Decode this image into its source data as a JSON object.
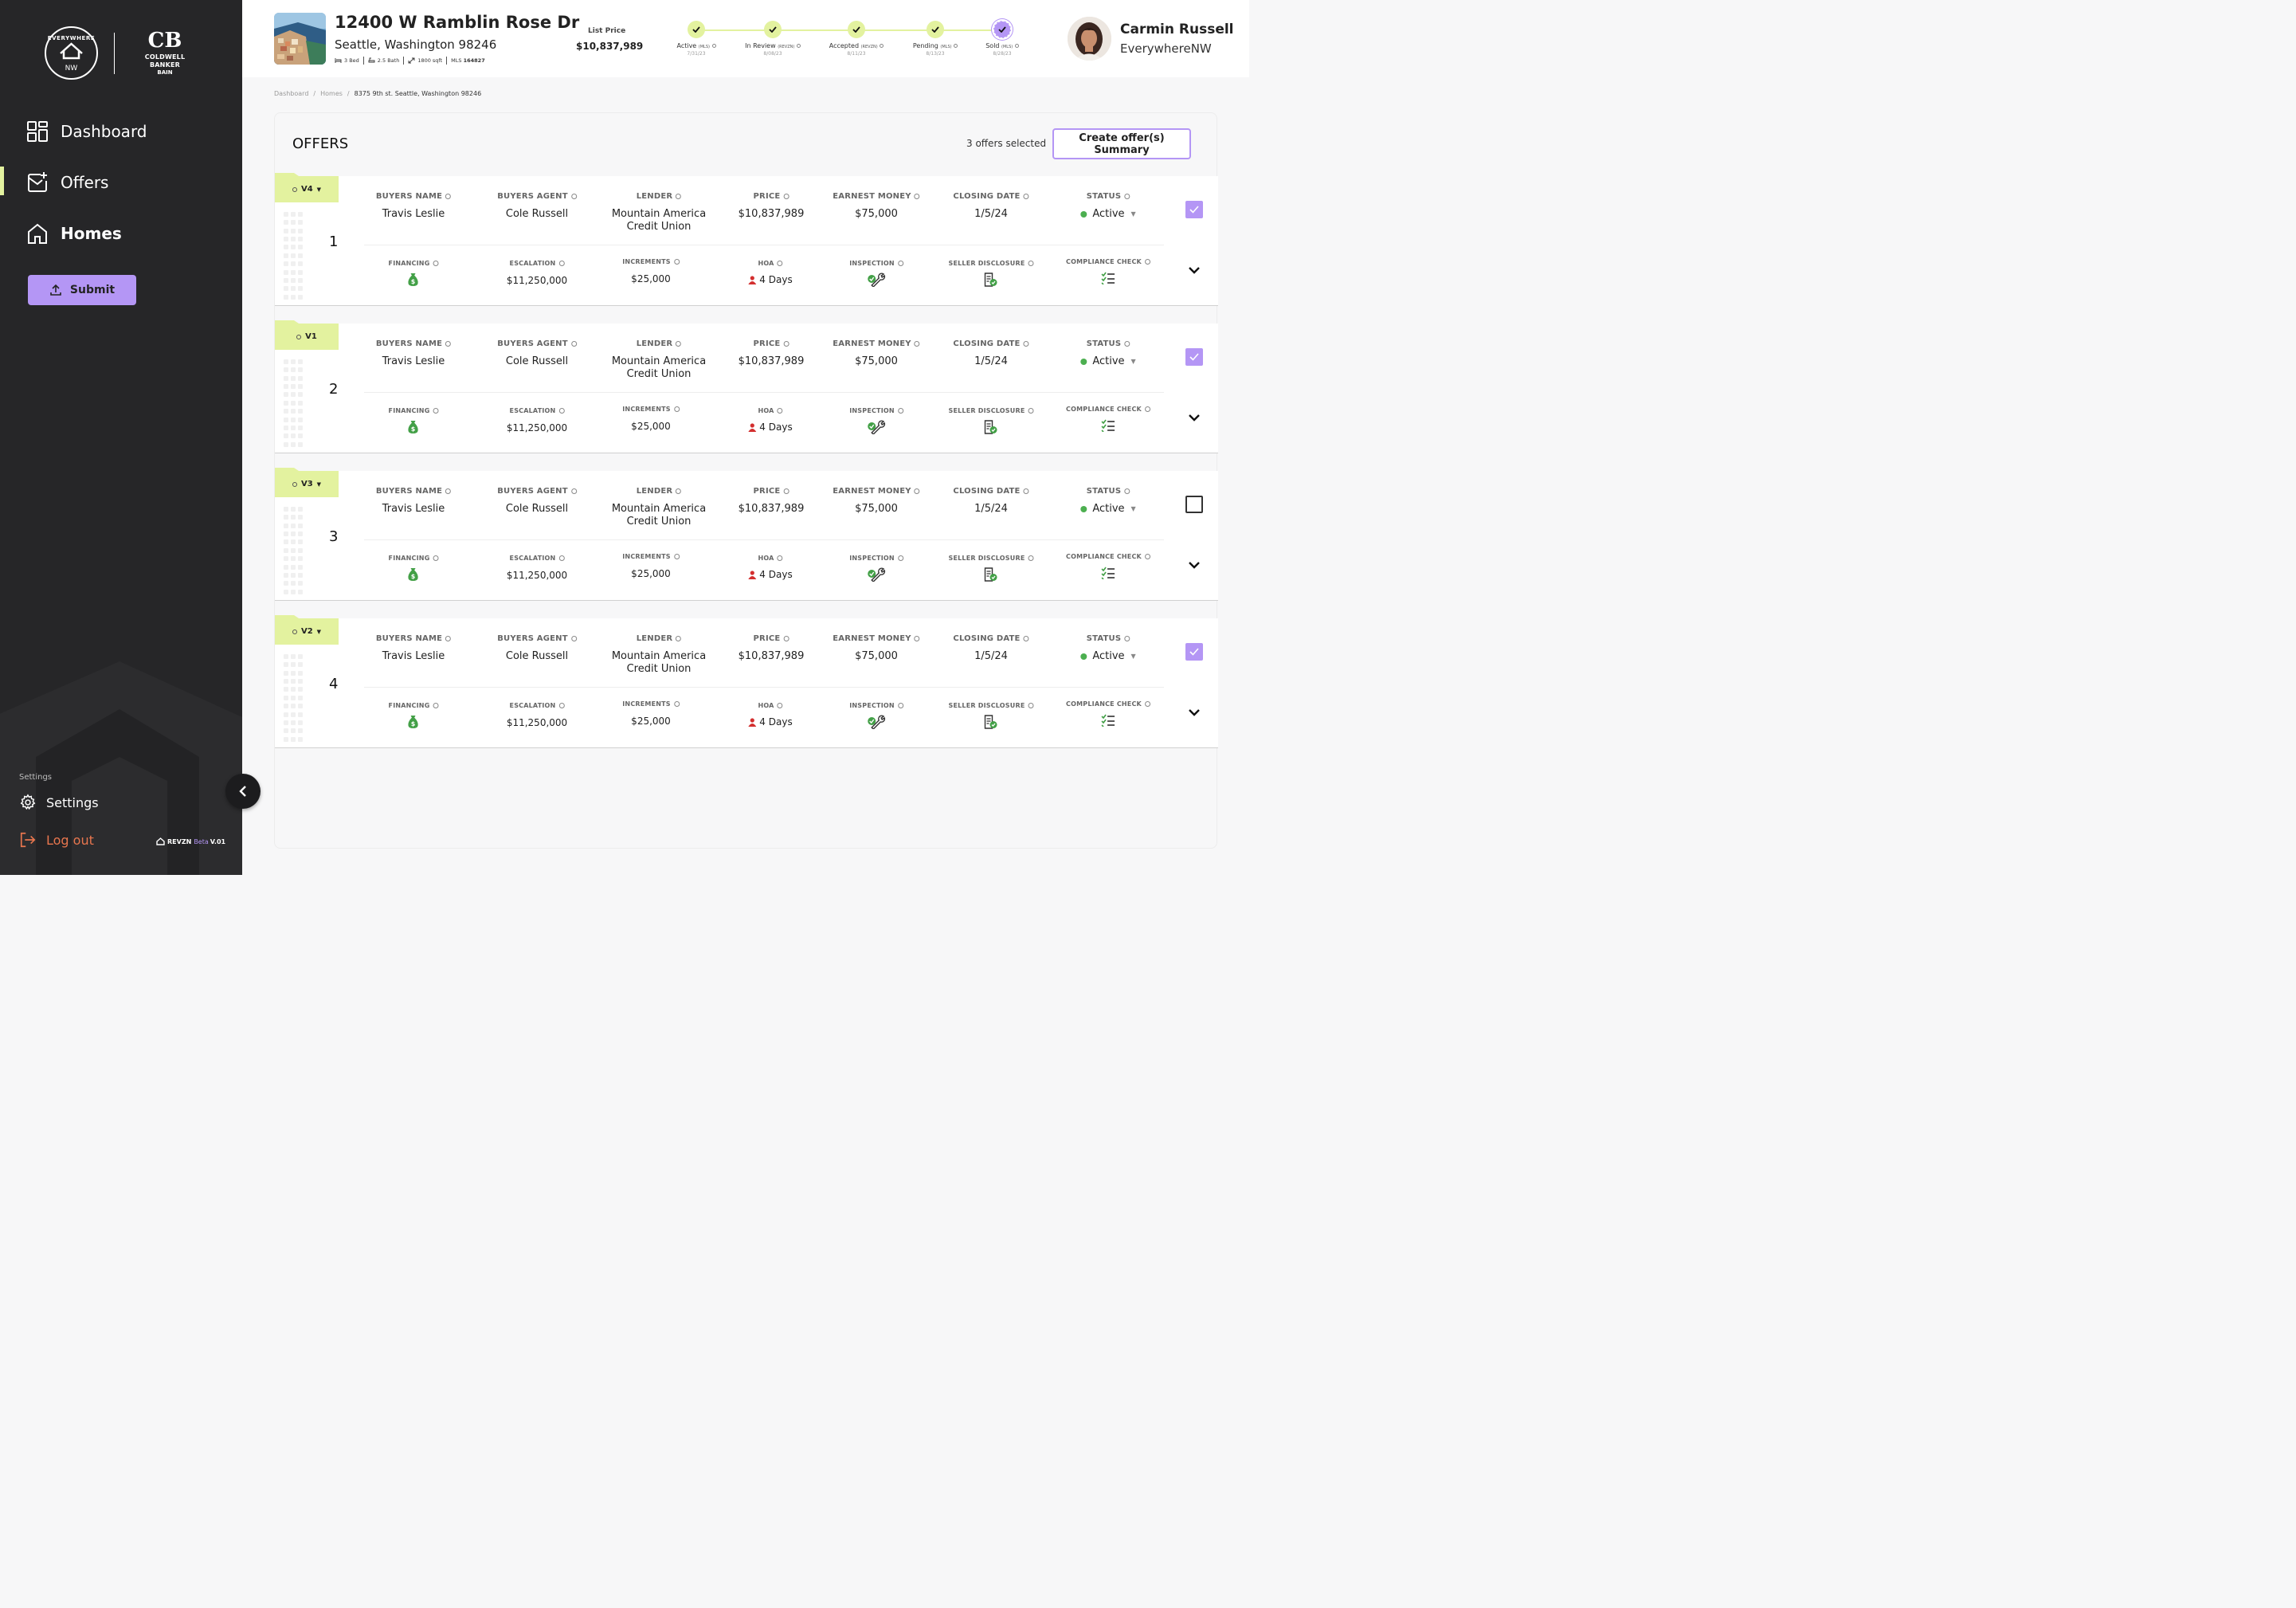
{
  "brand": {
    "logo_text": "EVERYWHERE NW",
    "partner_logo_name": "COLDWELL BANKER",
    "partner_logo_sub": "BAIN"
  },
  "sidebar": {
    "items": [
      {
        "label": "Dashboard",
        "icon": "dashboard-icon"
      },
      {
        "label": "Offers",
        "icon": "offers-icon",
        "active": true
      },
      {
        "label": "Homes",
        "icon": "home-icon"
      }
    ],
    "submit_label": "Submit",
    "settings_heading": "Settings",
    "settings_label": "Settings",
    "logout_label": "Log out",
    "version": {
      "name": "REVZN",
      "beta": "Beta",
      "ver": "V.01"
    }
  },
  "property": {
    "address": "12400 W Ramblin Rose Dr",
    "city": "Seattle, Washington 98246",
    "beds": "3 Bed",
    "baths": "2.5 Bath",
    "sqft": "1800 sqft",
    "mls_label": "MLS",
    "mls": "164827",
    "list_price_label": "List Price",
    "list_price": "$10,837,989"
  },
  "progress": [
    {
      "label": "Active",
      "tag": "(MLS)",
      "date": "7/31/23"
    },
    {
      "label": "In Review",
      "tag": "(REVZN)",
      "date": "8/08/23"
    },
    {
      "label": "Accepted",
      "tag": "(REVZN)",
      "date": "8/11/23"
    },
    {
      "label": "Pending",
      "tag": "(MLS)",
      "date": "8/13/23"
    },
    {
      "label": "Sold",
      "tag": "(MLS)",
      "date": "8/28/23"
    }
  ],
  "user": {
    "name": "Carmin Russell",
    "org": "EverywhereNW"
  },
  "breadcrumb": [
    "Dashboard",
    "Homes",
    "8375 9th st. Seattle, Washington 98246"
  ],
  "offers_section": {
    "title": "OFFERS",
    "selected_text": "3 offers selected",
    "summary_button": "Create offer(s) Summary"
  },
  "labels": {
    "buyers_name": "BUYERS NAME",
    "buyers_agent": "BUYERS AGENT",
    "lender": "LENDER",
    "price": "PRICE",
    "earnest_money": "EARNEST MONEY",
    "closing_date": "CLOSING DATE",
    "status": "STATUS",
    "financing": "FINANCING",
    "escalation": "ESCALATION",
    "increments": "INCREMENTS",
    "hoa": "HOA",
    "inspection": "INSPECTION",
    "seller_disclosure": "SELLER DISCLOSURE",
    "compliance_check": "COMPLIANCE CHECK"
  },
  "offers": [
    {
      "version": "V4",
      "index": "1",
      "buyer": "Travis Leslie",
      "agent": "Cole Russell",
      "lender_line1": "Mountain America",
      "lender_line2": "Credit Union",
      "price": "$10,837,989",
      "earnest": "$75,000",
      "closing": "1/5/24",
      "status": "Active",
      "escalation": "$11,250,000",
      "increments": "$25,000",
      "hoa": "4 Days",
      "selected": true,
      "has_caret": true
    },
    {
      "version": "V1",
      "index": "2",
      "buyer": "Travis Leslie",
      "agent": "Cole Russell",
      "lender_line1": "Mountain America",
      "lender_line2": "Credit Union",
      "price": "$10,837,989",
      "earnest": "$75,000",
      "closing": "1/5/24",
      "status": "Active",
      "escalation": "$11,250,000",
      "increments": "$25,000",
      "hoa": "4 Days",
      "selected": true,
      "has_caret": false
    },
    {
      "version": "V3",
      "index": "3",
      "buyer": "Travis Leslie",
      "agent": "Cole Russell",
      "lender_line1": "Mountain America",
      "lender_line2": "Credit Union",
      "price": "$10,837,989",
      "earnest": "$75,000",
      "closing": "1/5/24",
      "status": "Active",
      "escalation": "$11,250,000",
      "increments": "$25,000",
      "hoa": "4 Days",
      "selected": false,
      "has_caret": true
    },
    {
      "version": "V2",
      "index": "4",
      "buyer": "Travis Leslie",
      "agent": "Cole Russell",
      "lender_line1": "Mountain America",
      "lender_line2": "Credit Union",
      "price": "$10,837,989",
      "earnest": "$75,000",
      "closing": "1/5/24",
      "status": "Active",
      "escalation": "$11,250,000",
      "increments": "$25,000",
      "hoa": "4 Days",
      "selected": true,
      "has_caret": true
    }
  ],
  "colors": {
    "accent_lime": "#e3f29f",
    "accent_purple": "#b496f5",
    "sidebar_bg": "#262628",
    "status_active": "#4caf50",
    "logout": "#e8764e",
    "hoa_icon": "#d32f2f"
  }
}
